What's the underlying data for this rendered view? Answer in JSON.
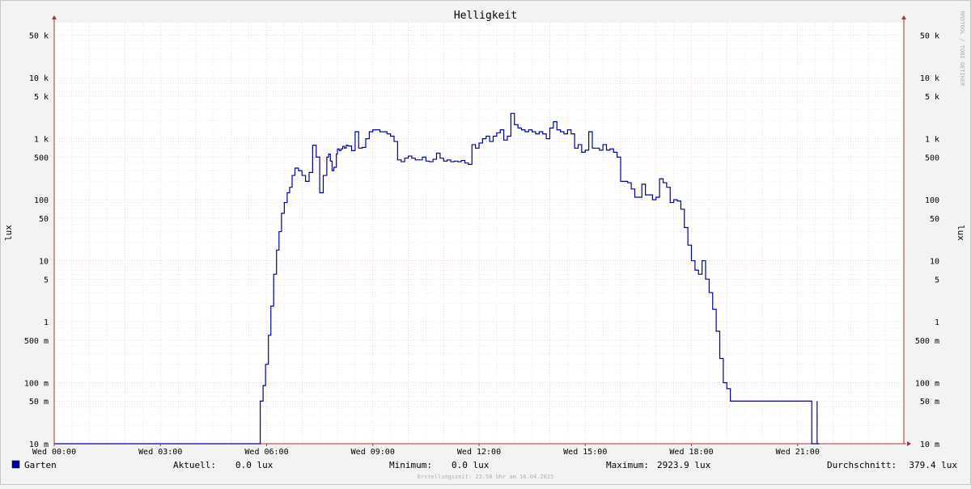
{
  "chart_data": {
    "type": "line",
    "title": "Helligkeit",
    "ylabel": "lux",
    "ylabel_right": "lux",
    "watermark": "RRDTOOL / TOBI OETIKER",
    "y_scale": "log",
    "ylim": [
      0.01,
      80000
    ],
    "xlim_hours": [
      0,
      24
    ],
    "x_ticks": [
      {
        "hour": 0,
        "label": "Wed 00:00"
      },
      {
        "hour": 3,
        "label": "Wed 03:00"
      },
      {
        "hour": 6,
        "label": "Wed 06:00"
      },
      {
        "hour": 9,
        "label": "Wed 09:00"
      },
      {
        "hour": 12,
        "label": "Wed 12:00"
      },
      {
        "hour": 15,
        "label": "Wed 15:00"
      },
      {
        "hour": 18,
        "label": "Wed 18:00"
      },
      {
        "hour": 21,
        "label": "Wed 21:00"
      }
    ],
    "y_ticks": [
      {
        "value": 0.01,
        "label": "10 m"
      },
      {
        "value": 0.05,
        "label": "50 m"
      },
      {
        "value": 0.1,
        "label": "100 m"
      },
      {
        "value": 0.5,
        "label": "500 m"
      },
      {
        "value": 1,
        "label": "1"
      },
      {
        "value": 5,
        "label": "5"
      },
      {
        "value": 10,
        "label": "10"
      },
      {
        "value": 50,
        "label": "50"
      },
      {
        "value": 100,
        "label": "100"
      },
      {
        "value": 500,
        "label": "500"
      },
      {
        "value": 1000,
        "label": "1 k"
      },
      {
        "value": 5000,
        "label": "5 k"
      },
      {
        "value": 10000,
        "label": "10 k"
      },
      {
        "value": 50000,
        "label": "50 k"
      }
    ],
    "series": [
      {
        "name": "Garten",
        "color": "#0000a0",
        "x_hours": [
          5.8,
          5.82,
          5.9,
          5.97,
          6.05,
          6.12,
          6.2,
          6.28,
          6.35,
          6.42,
          6.5,
          6.58,
          6.65,
          6.72,
          6.8,
          6.9,
          7.0,
          7.1,
          7.2,
          7.3,
          7.4,
          7.5,
          7.6,
          7.7,
          7.75,
          7.8,
          7.85,
          7.9,
          7.97,
          8.0,
          8.05,
          8.1,
          8.15,
          8.2,
          8.25,
          8.3,
          8.4,
          8.5,
          8.6,
          8.7,
          8.8,
          8.9,
          9.0,
          9.1,
          9.2,
          9.3,
          9.4,
          9.5,
          9.6,
          9.7,
          9.8,
          9.9,
          10.0,
          10.1,
          10.2,
          10.3,
          10.4,
          10.5,
          10.6,
          10.7,
          10.8,
          10.9,
          11.0,
          11.1,
          11.2,
          11.3,
          11.4,
          11.5,
          11.6,
          11.7,
          11.8,
          11.9,
          12.0,
          12.1,
          12.2,
          12.3,
          12.4,
          12.5,
          12.6,
          12.7,
          12.8,
          12.9,
          13.0,
          13.1,
          13.2,
          13.3,
          13.4,
          13.5,
          13.6,
          13.7,
          13.8,
          13.9,
          14.0,
          14.1,
          14.2,
          14.3,
          14.4,
          14.5,
          14.6,
          14.7,
          14.8,
          14.9,
          15.0,
          15.1,
          15.2,
          15.3,
          15.4,
          15.5,
          15.6,
          15.7,
          15.8,
          15.9,
          16.0,
          16.1,
          16.2,
          16.3,
          16.4,
          16.5,
          16.6,
          16.7,
          16.8,
          16.9,
          17.0,
          17.1,
          17.2,
          17.3,
          17.4,
          17.5,
          17.6,
          17.7,
          17.8,
          17.9,
          18.0,
          18.1,
          18.2,
          18.3,
          18.4,
          18.5,
          18.6,
          18.7,
          18.8,
          18.9,
          19.0,
          19.1,
          19.2,
          19.3,
          19.4,
          19.5,
          19.6,
          19.7,
          19.8,
          19.9,
          20.0,
          20.1,
          20.2,
          20.3,
          20.4,
          20.5,
          20.6,
          20.7,
          20.8,
          20.9,
          21.0,
          21.05,
          21.1,
          21.2,
          21.3,
          21.4,
          21.5,
          21.55,
          21.6,
          21.62
        ],
        "values": [
          0.01,
          0.05,
          0.09,
          0.2,
          0.6,
          1.8,
          6,
          15,
          30,
          60,
          90,
          130,
          160,
          250,
          330,
          300,
          250,
          200,
          280,
          780,
          500,
          130,
          250,
          500,
          560,
          430,
          300,
          340,
          560,
          680,
          640,
          680,
          750,
          700,
          780,
          760,
          640,
          1300,
          700,
          720,
          1000,
          1300,
          1400,
          1400,
          1300,
          1300,
          1200,
          1100,
          900,
          450,
          420,
          480,
          520,
          480,
          450,
          450,
          500,
          430,
          420,
          460,
          580,
          480,
          430,
          450,
          420,
          430,
          420,
          440,
          400,
          380,
          800,
          700,
          850,
          1000,
          1100,
          900,
          1100,
          1250,
          1400,
          950,
          1100,
          2600,
          1700,
          1500,
          1400,
          1300,
          1400,
          1300,
          1200,
          1300,
          1200,
          1000,
          1500,
          1900,
          1400,
          1300,
          1200,
          1400,
          1200,
          700,
          800,
          600,
          650,
          1300,
          700,
          700,
          650,
          800,
          650,
          680,
          600,
          500,
          200,
          200,
          190,
          150,
          110,
          110,
          180,
          120,
          120,
          100,
          110,
          220,
          190,
          160,
          90,
          100,
          95,
          70,
          35,
          18,
          10,
          7,
          6,
          10,
          5,
          3,
          1.6,
          0.7,
          0.25,
          0.1,
          0.08,
          0.05,
          0.05,
          0.05,
          0.05,
          0.05,
          0.05,
          0.05,
          0.05,
          0.05,
          0.05,
          0.05,
          0.05,
          0.05,
          0.05,
          0.05,
          0.05,
          0.05,
          0.05,
          0.05,
          0.05,
          0.05,
          0.05,
          0.05,
          0.05,
          0.01,
          0.01,
          0.01,
          0.01,
          0.01
        ],
        "spikes": [
          {
            "hour": 21.55,
            "value": 0.05
          }
        ]
      }
    ]
  },
  "legend": {
    "series_name": "Garten",
    "series_color": "#0000a0",
    "aktuell_label": "Aktuell:",
    "aktuell_value": "0.0 lux",
    "minimum_label": "Minimum:",
    "minimum_value": "0.0 lux",
    "maximum_label": "Maximum:",
    "maximum_value": "2923.9 lux",
    "durchschnitt_label": "Durchschnitt:",
    "durchschnitt_value": "379.4 lux"
  },
  "footer": {
    "timestamp": "Erstellungszeit: 23:58 Uhr am 16.04.2025"
  }
}
